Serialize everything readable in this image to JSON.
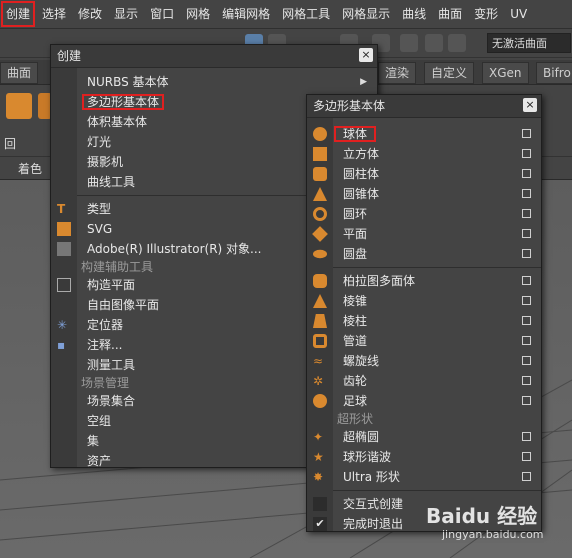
{
  "menubar": {
    "items": [
      "创建",
      "选择",
      "修改",
      "显示",
      "窗口",
      "网格",
      "编辑网格",
      "网格工具",
      "网格显示",
      "曲线",
      "曲面",
      "变形",
      "UV"
    ]
  },
  "toolbar": {
    "state_dropdown": "无激活曲面"
  },
  "shelf": {
    "left_tab": "曲面",
    "tabs": [
      "渲染",
      "自定义",
      "XGen",
      "Bifro"
    ]
  },
  "side_labels": {
    "row3_left": "回",
    "row4_left": "着色"
  },
  "create_menu": {
    "title": "创建",
    "close": "×",
    "items": [
      {
        "label": "NURBS 基本体",
        "submenu": true
      },
      {
        "label": "多边形基本体",
        "submenu": true
      },
      {
        "label": "体积基本体",
        "submenu": true
      },
      {
        "label": "灯光",
        "submenu": true
      },
      {
        "label": "摄影机",
        "submenu": true
      },
      {
        "label": "曲线工具",
        "submenu": true
      }
    ],
    "items2": [
      "类型",
      "SVG",
      "Adobe(R) Illustrator(R) 对象..."
    ],
    "section1": "构建辅助工具",
    "items3": [
      "构造平面",
      "自由图像平面",
      "定位器",
      "注释...",
      "测量工具"
    ],
    "section2": "场景管理",
    "items4": [
      "场景集合",
      "空组",
      "集",
      "资产"
    ]
  },
  "poly_menu": {
    "title": "多边形基本体",
    "close": "×",
    "items": [
      "球体",
      "立方体",
      "圆柱体",
      "圆锥体",
      "圆环",
      "平面",
      "圆盘"
    ],
    "items2": [
      "柏拉图多面体",
      "棱锥",
      "棱柱",
      "管道",
      "螺旋线",
      "齿轮",
      "足球"
    ],
    "section": "超形状",
    "items3": [
      "超椭圆",
      "球形谐波",
      "Ultra 形状"
    ],
    "items4": [
      "交互式创建",
      "完成时退出"
    ],
    "checked": "✔"
  },
  "watermark": {
    "brand": "Baidu 经验",
    "url": "jingyan.baidu.com"
  },
  "colors": {
    "highlight": "#e02020",
    "bg": "#444444"
  }
}
